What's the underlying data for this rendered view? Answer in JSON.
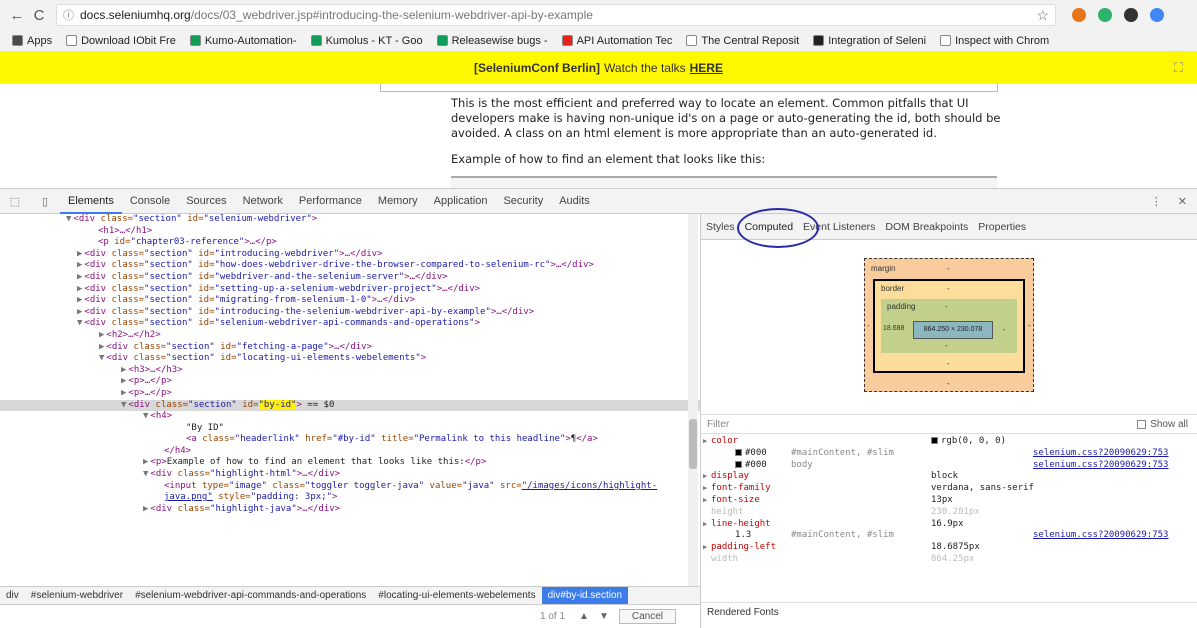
{
  "browser": {
    "url_host": "docs.seleniumhq.org",
    "url_path": "/docs/03_webdriver.jsp#introducing-the-selenium-webdriver-api-by-example",
    "back_icon": "←",
    "reload_icon": "C",
    "lock_icon": "ⓘ",
    "star_icon": "☆",
    "extension_colors": [
      "#e8751a",
      "#2db36b",
      "#333333",
      "#4285f4"
    ]
  },
  "bookmarks": [
    {
      "label": "Apps",
      "color": "#4a4a4a"
    },
    {
      "label": "Download IObit Fre",
      "color": "#ffffff"
    },
    {
      "label": "Kumo-Automation-",
      "color": "#0f9d58"
    },
    {
      "label": "Kumolus - KT - Goo",
      "color": "#0f9d58"
    },
    {
      "label": "Releasewise bugs -",
      "color": "#0f9d58"
    },
    {
      "label": "API Automation Tec",
      "color": "#e62117"
    },
    {
      "label": "The Central Reposit",
      "color": "#ffffff"
    },
    {
      "label": "Integration of Seleni",
      "color": "#222222"
    },
    {
      "label": "Inspect with Chrom",
      "color": "#ffffff"
    }
  ],
  "banner": {
    "bold": "[SeleniumConf Berlin]",
    "text": "Watch the talks",
    "link": "HERE",
    "close_icon": "⛶"
  },
  "page": {
    "paragraph": "This is the most efficient and preferred way to locate an element. Common pitfalls that UI developers make is having non-unique id's on a page or auto-generating the id, both should be avoided. A class on an html element is more appropriate than an auto-generated id.",
    "example": "Example of how to find an element that looks like this:"
  },
  "devtools": {
    "inspect_icon": "⬚",
    "device_icon": "▯",
    "tabs": [
      "Elements",
      "Console",
      "Sources",
      "Network",
      "Performance",
      "Memory",
      "Application",
      "Security",
      "Audits"
    ],
    "menu_icon": "⋮",
    "close_icon": "✕",
    "dom_lines": [
      {
        "indent": 6,
        "tri": "▼",
        "html": "<span class=\"tag\">&lt;div</span> <span class=\"attr\">class=</span><span class=\"val\">\"section\"</span> <span class=\"attr\">id=</span><span class=\"val\">\"selenium-webdriver\"</span><span class=\"tag\">&gt;</span>"
      },
      {
        "indent": 8,
        "tri": "",
        "html": "<span class=\"tag\">&lt;h1&gt;</span>…<span class=\"tag\">&lt;/h1&gt;</span>"
      },
      {
        "indent": 8,
        "tri": "",
        "html": "<span class=\"tag\">&lt;p</span> <span class=\"attr\">id=</span><span class=\"val\">\"chapter03-reference\"</span><span class=\"tag\">&gt;</span>…<span class=\"tag\">&lt;/p&gt;</span>"
      },
      {
        "indent": 7,
        "tri": "▶",
        "html": "<span class=\"tag\">&lt;div</span> <span class=\"attr\">class=</span><span class=\"val\">\"section\"</span> <span class=\"attr\">id=</span><span class=\"val\">\"introducing-webdriver\"</span><span class=\"tag\">&gt;</span>…<span class=\"tag\">&lt;/div&gt;</span>"
      },
      {
        "indent": 7,
        "tri": "▶",
        "html": "<span class=\"tag\">&lt;div</span> <span class=\"attr\">class=</span><span class=\"val\">\"section\"</span> <span class=\"attr\">id=</span><span class=\"val\">\"how-does-webdriver-drive-the-browser-compared-to-selenium-rc\"</span><span class=\"tag\">&gt;</span>…<span class=\"tag\">&lt;/div&gt;</span>"
      },
      {
        "indent": 7,
        "tri": "▶",
        "html": "<span class=\"tag\">&lt;div</span> <span class=\"attr\">class=</span><span class=\"val\">\"section\"</span> <span class=\"attr\">id=</span><span class=\"val\">\"webdriver-and-the-selenium-server\"</span><span class=\"tag\">&gt;</span>…<span class=\"tag\">&lt;/div&gt;</span>"
      },
      {
        "indent": 7,
        "tri": "▶",
        "html": "<span class=\"tag\">&lt;div</span> <span class=\"attr\">class=</span><span class=\"val\">\"section\"</span> <span class=\"attr\">id=</span><span class=\"val\">\"setting-up-a-selenium-webdriver-project\"</span><span class=\"tag\">&gt;</span>…<span class=\"tag\">&lt;/div&gt;</span>"
      },
      {
        "indent": 7,
        "tri": "▶",
        "html": "<span class=\"tag\">&lt;div</span> <span class=\"attr\">class=</span><span class=\"val\">\"section\"</span> <span class=\"attr\">id=</span><span class=\"val\">\"migrating-from-selenium-1-0\"</span><span class=\"tag\">&gt;</span>…<span class=\"tag\">&lt;/div&gt;</span>"
      },
      {
        "indent": 7,
        "tri": "▶",
        "html": "<span class=\"tag\">&lt;div</span> <span class=\"attr\">class=</span><span class=\"val\">\"section\"</span> <span class=\"attr\">id=</span><span class=\"val\">\"introducing-the-selenium-webdriver-api-by-example\"</span><span class=\"tag\">&gt;</span>…<span class=\"tag\">&lt;/div&gt;</span>"
      },
      {
        "indent": 7,
        "tri": "▼",
        "html": "<span class=\"tag\">&lt;div</span> <span class=\"attr\">class=</span><span class=\"val\">\"section\"</span> <span class=\"attr\">id=</span><span class=\"val\">\"selenium-webdriver-api-commands-and-operations\"</span><span class=\"tag\">&gt;</span>"
      },
      {
        "indent": 9,
        "tri": "▶",
        "html": "<span class=\"tag\">&lt;h2&gt;</span>…<span class=\"tag\">&lt;/h2&gt;</span>"
      },
      {
        "indent": 9,
        "tri": "▶",
        "html": "<span class=\"tag\">&lt;div</span> <span class=\"attr\">class=</span><span class=\"val\">\"section\"</span> <span class=\"attr\">id=</span><span class=\"val\">\"fetching-a-page\"</span><span class=\"tag\">&gt;</span>…<span class=\"tag\">&lt;/div&gt;</span>"
      },
      {
        "indent": 9,
        "tri": "▼",
        "html": "<span class=\"tag\">&lt;div</span> <span class=\"attr\">class=</span><span class=\"val\">\"section\"</span> <span class=\"attr\">id=</span><span class=\"val\">\"locating-ui-elements-webelements\"</span><span class=\"tag\">&gt;</span>"
      },
      {
        "indent": 11,
        "tri": "▶",
        "html": "<span class=\"tag\">&lt;h3&gt;</span>…<span class=\"tag\">&lt;/h3&gt;</span>"
      },
      {
        "indent": 11,
        "tri": "▶",
        "html": "<span class=\"tag\">&lt;p&gt;</span>…<span class=\"tag\">&lt;/p&gt;</span>"
      },
      {
        "indent": 11,
        "tri": "▶",
        "html": "<span class=\"tag\">&lt;p&gt;</span>…<span class=\"tag\">&lt;/p&gt;</span>"
      },
      {
        "indent": 11,
        "tri": "▼",
        "hl": true,
        "html": "<span class=\"tag\">&lt;div</span> <span class=\"attr\">class=</span><span class=\"val\">\"section\"</span> <span class=\"attr\">id=</span><span class=\"val mark\">\"by-id\"</span><span class=\"tag\">&gt;</span> <span class=\"txt\">== $0</span>"
      },
      {
        "indent": 13,
        "tri": "▼",
        "html": "<span class=\"tag\">&lt;h4&gt;</span>"
      },
      {
        "indent": 16,
        "tri": "",
        "html": "<span class=\"txt\">\"By ID\"</span>"
      },
      {
        "indent": 16,
        "tri": "",
        "html": "<span class=\"tag\">&lt;a</span> <span class=\"attr\">class=</span><span class=\"val\">\"headerlink\"</span> <span class=\"attr\">href=</span><span class=\"val\">\"#by-id\"</span> <span class=\"attr\">title=</span><span class=\"val\">\"Permalink to this headline\"</span><span class=\"tag\">&gt;</span><span class=\"txt\">¶</span><span class=\"tag\">&lt;/a&gt;</span>"
      },
      {
        "indent": 14,
        "tri": "",
        "html": "<span class=\"tag\">&lt;/h4&gt;</span>"
      },
      {
        "indent": 13,
        "tri": "▶",
        "html": "<span class=\"tag\">&lt;p&gt;</span><span class=\"txt\">Example of how to find an element that looks like this:</span><span class=\"tag\">&lt;/p&gt;</span>"
      },
      {
        "indent": 13,
        "tri": "▼",
        "html": "<span class=\"tag\">&lt;div</span> <span class=\"attr\">class=</span><span class=\"val\">\"highlight-html\"</span><span class=\"tag\">&gt;</span>…<span class=\"tag\">&lt;/div&gt;</span>"
      },
      {
        "indent": 14,
        "tri": "",
        "html": "<span class=\"tag\">&lt;input</span> <span class=\"attr\">type=</span><span class=\"val\">\"image\"</span> <span class=\"attr\">class=</span><span class=\"val\">\"toggler toggler-java\"</span> <span class=\"attr\">value=</span><span class=\"val\">\"java\"</span> <span class=\"attr\">src=</span><span class=\"val\" style=\"text-decoration:underline\">\"/images/icons/highlight-</span>"
      },
      {
        "indent": 14,
        "tri": "",
        "html": "<span class=\"val\" style=\"text-decoration:underline\">java.png\"</span> <span class=\"attr\">style=</span><span class=\"val\">\"padding: 3px;\"</span><span class=\"tag\">&gt;</span>"
      },
      {
        "indent": 13,
        "tri": "▶",
        "html": "<span class=\"tag\">&lt;div</span> <span class=\"attr\">class=</span><span class=\"val\">\"highlight-java\"</span><span class=\"tag\">&gt;</span>…<span class=\"tag\">&lt;/div&gt;</span>"
      }
    ],
    "breadcrumbs": [
      "div",
      "#selenium-webdriver",
      "#selenium-webdriver-api-commands-and-operations",
      "#locating-ui-elements-webelements",
      "div#by-id.section"
    ],
    "find": {
      "count": "1 of 1",
      "up_icon": "▲",
      "down_icon": "▼",
      "cancel": "Cancel"
    },
    "side_tabs": [
      "Styles",
      "Computed",
      "Event Listeners",
      "DOM Breakpoints",
      "Properties"
    ],
    "box_model": {
      "margin": "margin",
      "border": "border",
      "padding": "padding",
      "dash": "-",
      "padding_left": "18.688",
      "content": "864.250 × 230.078"
    },
    "filter": {
      "placeholder": "Filter",
      "show_all": "Show all"
    },
    "props": [
      {
        "kind": "prop",
        "name": "color",
        "value": "rgb(0, 0, 0)",
        "swatch": true
      },
      {
        "kind": "sub",
        "value": "#000",
        "selector": "#mainContent, #slim",
        "source": "selenium.css?20090629:753"
      },
      {
        "kind": "sub",
        "value": "#000",
        "selector": "body",
        "source": "selenium.css?20090629:753"
      },
      {
        "kind": "prop",
        "name": "display",
        "value": "block"
      },
      {
        "kind": "prop",
        "name": "font-family",
        "value": "verdana, sans-serif"
      },
      {
        "kind": "prop",
        "name": "font-size",
        "value": "13px"
      },
      {
        "kind": "dim",
        "name": "height",
        "value": "230.281px"
      },
      {
        "kind": "prop",
        "name": "line-height",
        "value": "16.9px"
      },
      {
        "kind": "sub",
        "value": "1.3",
        "selector": "#mainContent, #slim",
        "source": "selenium.css?20090629:753"
      },
      {
        "kind": "prop",
        "name": "padding-left",
        "value": "18.6875px"
      },
      {
        "kind": "dim",
        "name": "width",
        "value": "864.25px"
      }
    ],
    "rendered_fonts": "Rendered Fonts"
  }
}
